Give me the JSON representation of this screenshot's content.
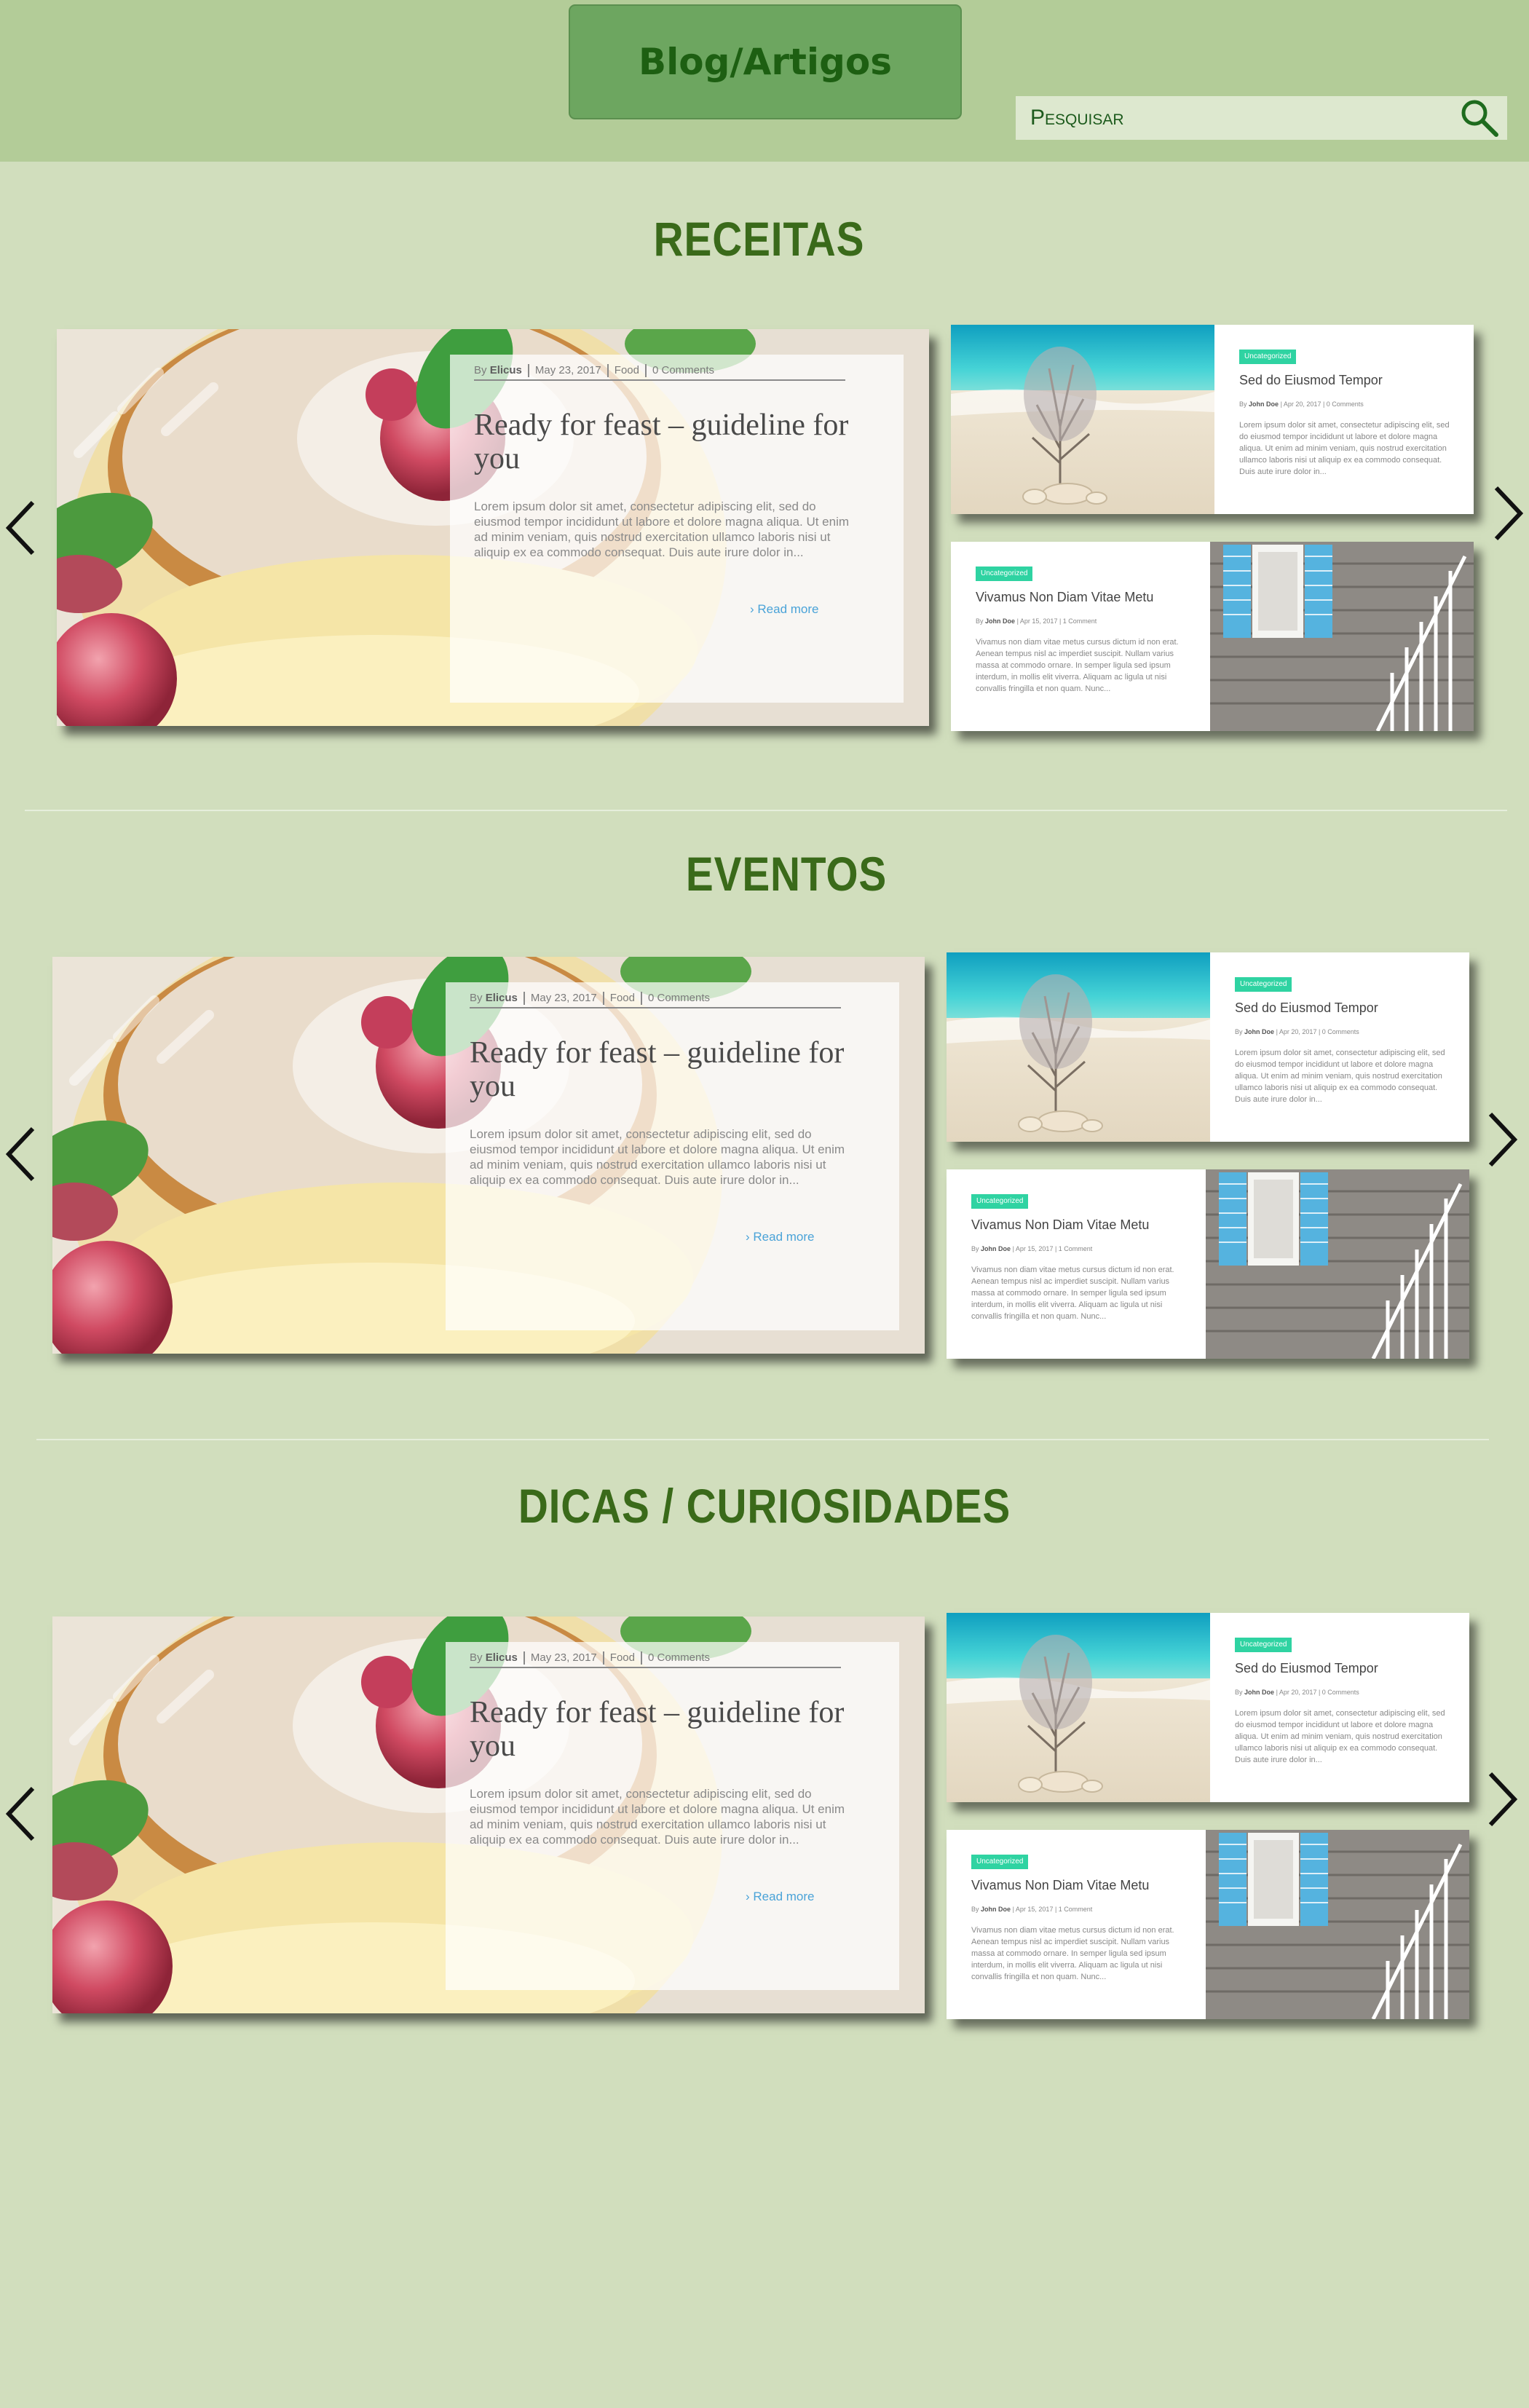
{
  "header": {
    "blog_label": "Blog/Artigos",
    "search_placeholder": "Pesquisar"
  },
  "sections": [
    {
      "title": "RECEITAS",
      "main": {
        "meta_by": "By",
        "meta_author": "Elicus",
        "meta_date": "May 23, 2017",
        "meta_category": "Food",
        "meta_comments": "0 Comments",
        "title": "Ready for feast – guideline for you",
        "excerpt": "Lorem ipsum dolor sit amet, consectetur adipiscing elit, sed do eiusmod tempor incididunt ut labore et dolore magna aliqua. Ut enim ad minim veniam, quis nostrud exercitation ullamco laboris nisi ut aliquip ex ea commodo consequat. Duis aute irure dolor in...",
        "read_more": "› Read more"
      },
      "side": [
        {
          "badge": "Uncategorized",
          "title": "Sed do Eiusmod Tempor",
          "meta_by": "By",
          "meta_author": "John Doe",
          "meta_rest": "| Apr 20, 2017 | 0 Comments",
          "excerpt": "Lorem ipsum dolor sit amet, consectetur adipiscing elit, sed do eiusmod tempor incididunt ut labore et dolore magna aliqua. Ut enim ad minim veniam, quis nostrud exercitation ullamco laboris nisi ut aliquip ex ea commodo consequat. Duis aute irure dolor in..."
        },
        {
          "badge": "Uncategorized",
          "title": "Vivamus Non Diam Vitae Metu",
          "meta_by": "By",
          "meta_author": "John Doe",
          "meta_rest": "| Apr 15, 2017 | 1 Comment",
          "excerpt": "Vivamus non diam vitae metus cursus dictum id non erat. Aenean tempus nisl ac imperdiet suscipit. Nullam varius massa at commodo ornare. In semper ligula sed ipsum interdum, in mollis elit viverra. Aliquam ac ligula ut nisi convallis fringilla et non quam. Nunc..."
        }
      ]
    },
    {
      "title": "EVENTOS",
      "main": {
        "meta_by": "By",
        "meta_author": "Elicus",
        "meta_date": "May 23, 2017",
        "meta_category": "Food",
        "meta_comments": "0 Comments",
        "title": "Ready for feast – guideline for you",
        "excerpt": "Lorem ipsum dolor sit amet, consectetur adipiscing elit, sed do eiusmod tempor incididunt ut labore et dolore magna aliqua. Ut enim ad minim veniam, quis nostrud exercitation ullamco laboris nisi ut aliquip ex ea commodo consequat. Duis aute irure dolor in...",
        "read_more": "› Read more"
      },
      "side": [
        {
          "badge": "Uncategorized",
          "title": "Sed do Eiusmod Tempor",
          "meta_by": "By",
          "meta_author": "John Doe",
          "meta_rest": "| Apr 20, 2017 | 0 Comments",
          "excerpt": "Lorem ipsum dolor sit amet, consectetur adipiscing elit, sed do eiusmod tempor incididunt ut labore et dolore magna aliqua. Ut enim ad minim veniam, quis nostrud exercitation ullamco laboris nisi ut aliquip ex ea commodo consequat. Duis aute irure dolor in..."
        },
        {
          "badge": "Uncategorized",
          "title": "Vivamus Non Diam Vitae Metu",
          "meta_by": "By",
          "meta_author": "John Doe",
          "meta_rest": "| Apr 15, 2017 | 1 Comment",
          "excerpt": "Vivamus non diam vitae metus cursus dictum id non erat. Aenean tempus nisl ac imperdiet suscipit. Nullam varius massa at commodo ornare. In semper ligula sed ipsum interdum, in mollis elit viverra. Aliquam ac ligula ut nisi convallis fringilla et non quam. Nunc..."
        }
      ]
    },
    {
      "title": "DICAS / CURIOSIDADES",
      "main": {
        "meta_by": "By",
        "meta_author": "Elicus",
        "meta_date": "May 23, 2017",
        "meta_category": "Food",
        "meta_comments": "0 Comments",
        "title": "Ready for feast – guideline for you",
        "excerpt": "Lorem ipsum dolor sit amet, consectetur adipiscing elit, sed do eiusmod tempor incididunt ut labore et dolore magna aliqua. Ut enim ad minim veniam, quis nostrud exercitation ullamco laboris nisi ut aliquip ex ea commodo consequat. Duis aute irure dolor in...",
        "read_more": "› Read more"
      },
      "side": [
        {
          "badge": "Uncategorized",
          "title": "Sed do Eiusmod Tempor",
          "meta_by": "By",
          "meta_author": "John Doe",
          "meta_rest": "| Apr 20, 2017 | 0 Comments",
          "excerpt": "Lorem ipsum dolor sit amet, consectetur adipiscing elit, sed do eiusmod tempor incididunt ut labore et dolore magna aliqua. Ut enim ad minim veniam, quis nostrud exercitation ullamco laboris nisi ut aliquip ex ea commodo consequat. Duis aute irure dolor in..."
        },
        {
          "badge": "Uncategorized",
          "title": "Vivamus Non Diam Vitae Metu",
          "meta_by": "By",
          "meta_author": "John Doe",
          "meta_rest": "| Apr 15, 2017 | 1 Comment",
          "excerpt": "Vivamus non diam vitae metus cursus dictum id non erat. Aenean tempus nisl ac imperdiet suscipit. Nullam varius massa at commodo ornare. In semper ligula sed ipsum interdum, in mollis elit viverra. Aliquam ac ligula ut nisi convallis fringilla et non quam. Nunc..."
        }
      ]
    }
  ]
}
